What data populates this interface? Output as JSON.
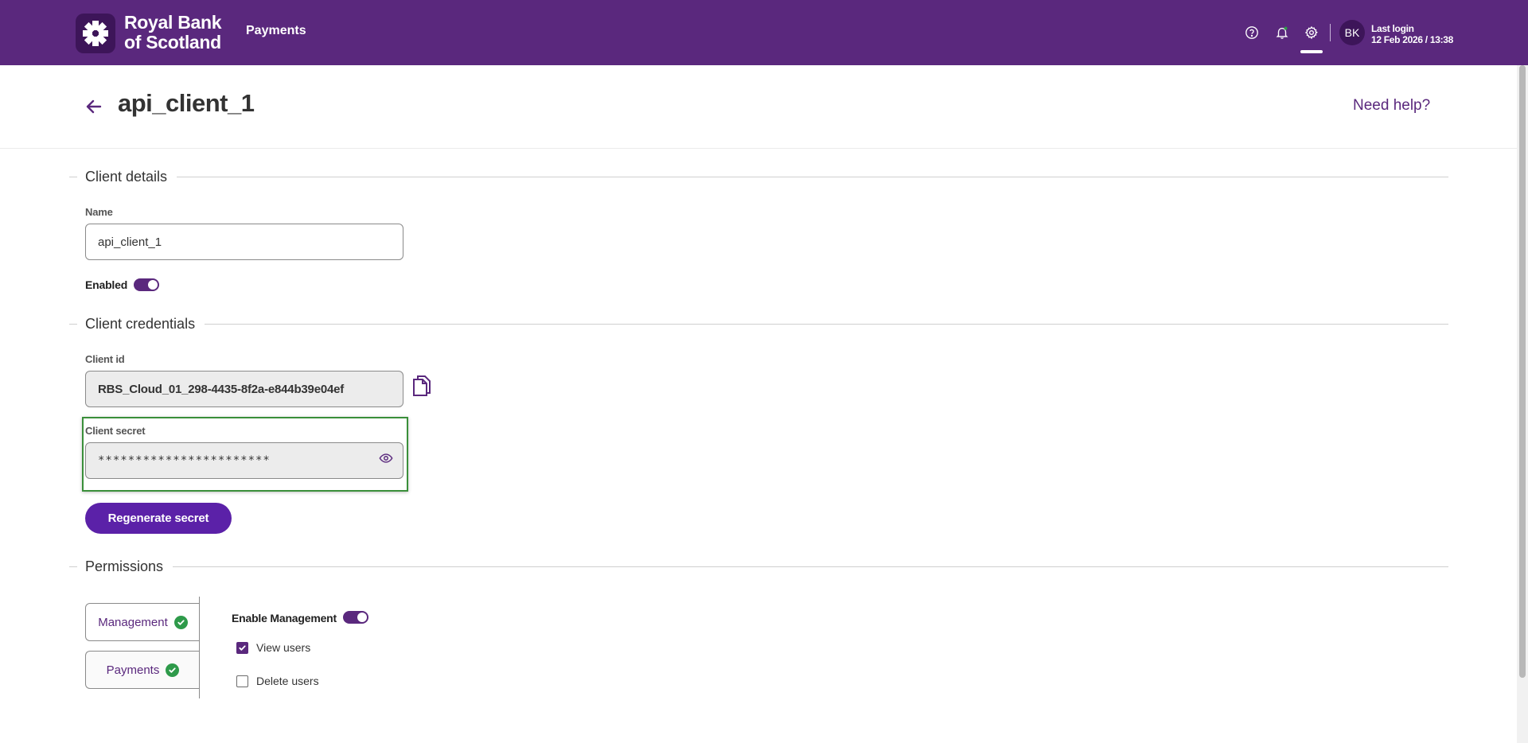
{
  "header": {
    "brand_line1": "Royal Bank",
    "brand_line2": "of Scotland",
    "nav_item": "Payments",
    "icons": [
      "help-icon",
      "bell-icon",
      "gear-icon"
    ],
    "avatar_initials": "BK",
    "last_login_label": "Last login",
    "last_login_value": "12 Feb 2026 / 13:38",
    "brand_color": "#5a287d"
  },
  "page": {
    "title": "api_client_1",
    "help_link": "Need help?"
  },
  "client_details": {
    "section_title": "Client details",
    "name_label": "Name",
    "name_value": "api_client_1",
    "enabled_label": "Enabled",
    "enabled": true
  },
  "client_credentials": {
    "section_title": "Client credentials",
    "client_id_label": "Client id",
    "client_id_value": "RBS_Cloud_01_298-4435-8f2a-e844b39e04ef",
    "client_secret_label": "Client secret",
    "client_secret_value": "***********************",
    "regenerate_label": "Regenerate secret"
  },
  "permissions": {
    "section_title": "Permissions",
    "tabs": [
      {
        "label": "Management",
        "complete": true
      },
      {
        "label": "Payments",
        "complete": true
      }
    ],
    "enable_label": "Enable Management",
    "enabled": true,
    "items": [
      {
        "label": "View users",
        "checked": true
      },
      {
        "label": "Delete users",
        "checked": false
      }
    ]
  }
}
